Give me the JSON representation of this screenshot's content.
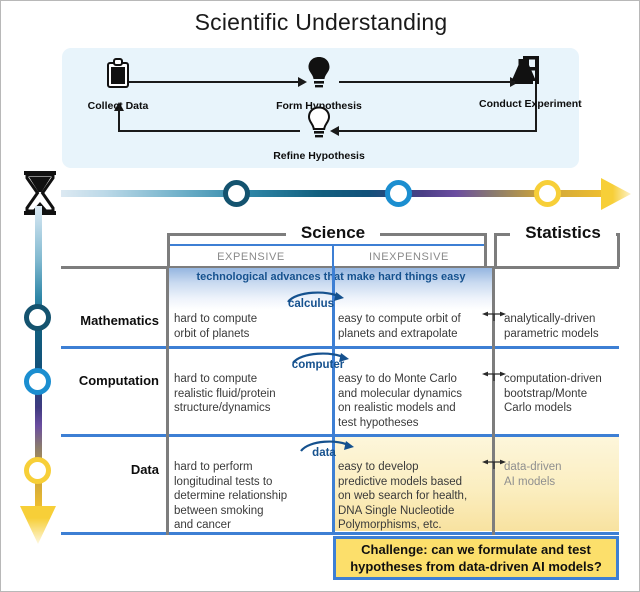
{
  "title": "Scientific Understanding",
  "flow": {
    "nodes": [
      {
        "label": "Collect Data",
        "icon": "clipboard-icon"
      },
      {
        "label": "Form Hypothesis",
        "icon": "lightbulb-filled-icon"
      },
      {
        "label": "Conduct Experiment",
        "icon": "flask-stand-icon"
      },
      {
        "label": "Refine Hypothesis",
        "icon": "lightbulb-outline-icon"
      }
    ]
  },
  "timeline": {
    "start_icon": "hourglass-icon",
    "markers": [
      {
        "name": "mathematics-marker",
        "color": "#14536f"
      },
      {
        "name": "computation-marker",
        "color": "#1b8ed0"
      },
      {
        "name": "data-marker",
        "color": "#f7cf38"
      }
    ]
  },
  "headers": {
    "science": "Science",
    "statistics": "Statistics",
    "expensive": "EXPENSIVE",
    "inexpensive": "INEXPENSIVE"
  },
  "banner": {
    "text": "technological advances that make hard things easy"
  },
  "rows": [
    {
      "label": "Mathematics",
      "advance": "calculus",
      "expensive": "hard to compute\norbit of planets",
      "inexpensive": "easy to compute orbit of\nplanets and extrapolate",
      "statistics": "analytically-driven\nparametric models"
    },
    {
      "label": "Computation",
      "advance": "computer",
      "expensive": "hard to compute\nrealistic fluid/protein\nstructure/dynamics",
      "inexpensive": "easy to do Monte Carlo\nand molecular dynamics\non realistic models and\ntest hypotheses",
      "statistics": "computation-driven\nbootstrap/Monte\nCarlo models"
    },
    {
      "label": "Data",
      "advance": "data",
      "expensive": "hard to perform\nlongitudinal tests to\ndetermine relationship\nbetween smoking\nand cancer",
      "inexpensive": "easy to develop\npredictive models based\non web search for health,\nDNA Single Nucleotide\nPolymorphisms, etc.",
      "statistics": "data-driven\nAI models"
    }
  ],
  "challenge": {
    "text": "Challenge: can we formulate and test hypotheses from data-driven AI models?"
  },
  "colors": {
    "panel_background": "#e8f4fb",
    "rule_blue": "#3d7fd4",
    "rule_gray": "#7d7d7d",
    "banner_blue": "#15518e",
    "highlight_yellow": "#fbeec0",
    "challenge_yellow": "#fcdf6b",
    "accent_gold": "#f7cf38"
  }
}
